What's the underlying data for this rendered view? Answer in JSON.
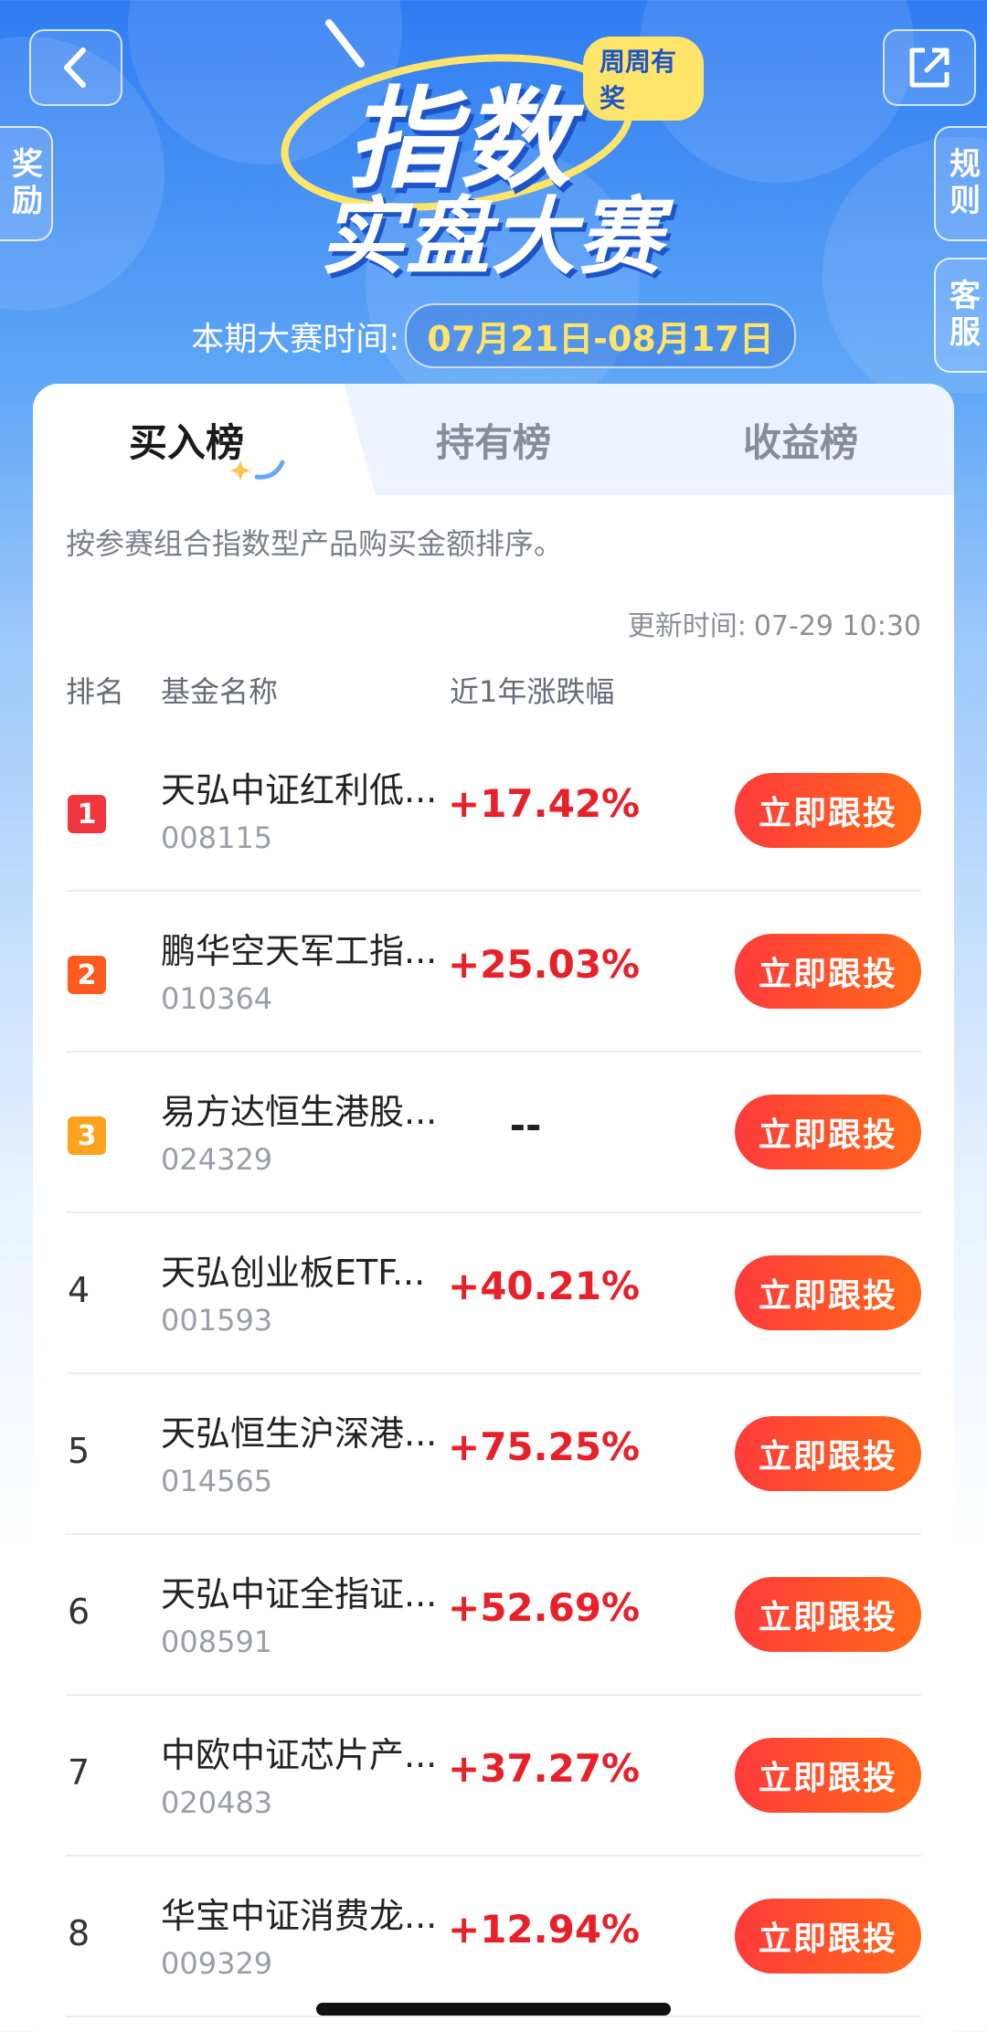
{
  "header": {
    "title_line1": "指数",
    "title_line2": "实盘大赛",
    "badge": "周周有奖",
    "period_label": "本期大赛时间:",
    "period_dates": "07月21日-08月17日"
  },
  "side_tabs": {
    "reward": "奖励",
    "rules": "规则",
    "service": "客服"
  },
  "tabs": [
    {
      "label": "买入榜",
      "active": true
    },
    {
      "label": "持有榜",
      "active": false
    },
    {
      "label": "收益榜",
      "active": false
    }
  ],
  "description": "按参赛组合指数型产品购买金额排序。",
  "update": {
    "label": "更新时间:",
    "value": "07-29 10:30"
  },
  "columns": {
    "rank": "排名",
    "name": "基金名称",
    "change": "近1年涨跌幅"
  },
  "rank_colors": {
    "1": "#f0353d",
    "2": "#ff5b1f",
    "3": "#ffa21e"
  },
  "follow_label": "立即跟投",
  "funds": [
    {
      "rank": "1",
      "name": "天弘中证红利低...",
      "code": "008115",
      "change": "+17.42%"
    },
    {
      "rank": "2",
      "name": "鹏华空天军工指...",
      "code": "010364",
      "change": "+25.03%"
    },
    {
      "rank": "3",
      "name": "易方达恒生港股...",
      "code": "024329",
      "change": "--"
    },
    {
      "rank": "4",
      "name": "天弘创业板ETF...",
      "code": "001593",
      "change": "+40.21%"
    },
    {
      "rank": "5",
      "name": "天弘恒生沪深港...",
      "code": "014565",
      "change": "+75.25%"
    },
    {
      "rank": "6",
      "name": "天弘中证全指证...",
      "code": "008591",
      "change": "+52.69%"
    },
    {
      "rank": "7",
      "name": "中欧中证芯片产...",
      "code": "020483",
      "change": "+37.27%"
    },
    {
      "rank": "8",
      "name": "华宝中证消费龙...",
      "code": "009329",
      "change": "+12.94%"
    }
  ]
}
